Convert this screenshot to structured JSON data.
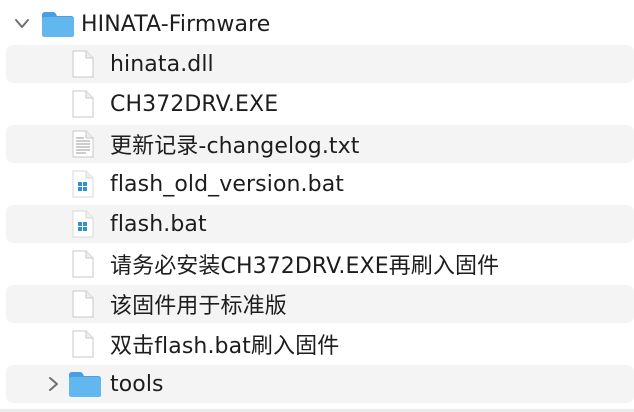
{
  "finder": {
    "folder": {
      "name": "HINATA-Firmware",
      "expanded": true,
      "icon": "folder-icon"
    },
    "items": [
      {
        "label": "hinata.dll",
        "icon": "document-icon"
      },
      {
        "label": "CH372DRV.EXE",
        "icon": "document-icon"
      },
      {
        "label": "更新记录-changelog.txt",
        "icon": "text-document-icon"
      },
      {
        "label": "flash_old_version.bat",
        "icon": "windows-batch-icon"
      },
      {
        "label": "flash.bat",
        "icon": "windows-batch-icon"
      },
      {
        "label": "请务必安装CH372DRV.EXE再刷入固件",
        "icon": "document-icon"
      },
      {
        "label": "该固件用于标准版",
        "icon": "document-icon"
      },
      {
        "label": "双击flash.bat刷入固件",
        "icon": "document-icon"
      }
    ],
    "subfolder": {
      "name": "tools",
      "expanded": false,
      "icon": "folder-icon"
    },
    "colors": {
      "folder": "#5bb3ec",
      "row_alt": "#f4f4f4",
      "text": "#1d1d1f"
    }
  }
}
